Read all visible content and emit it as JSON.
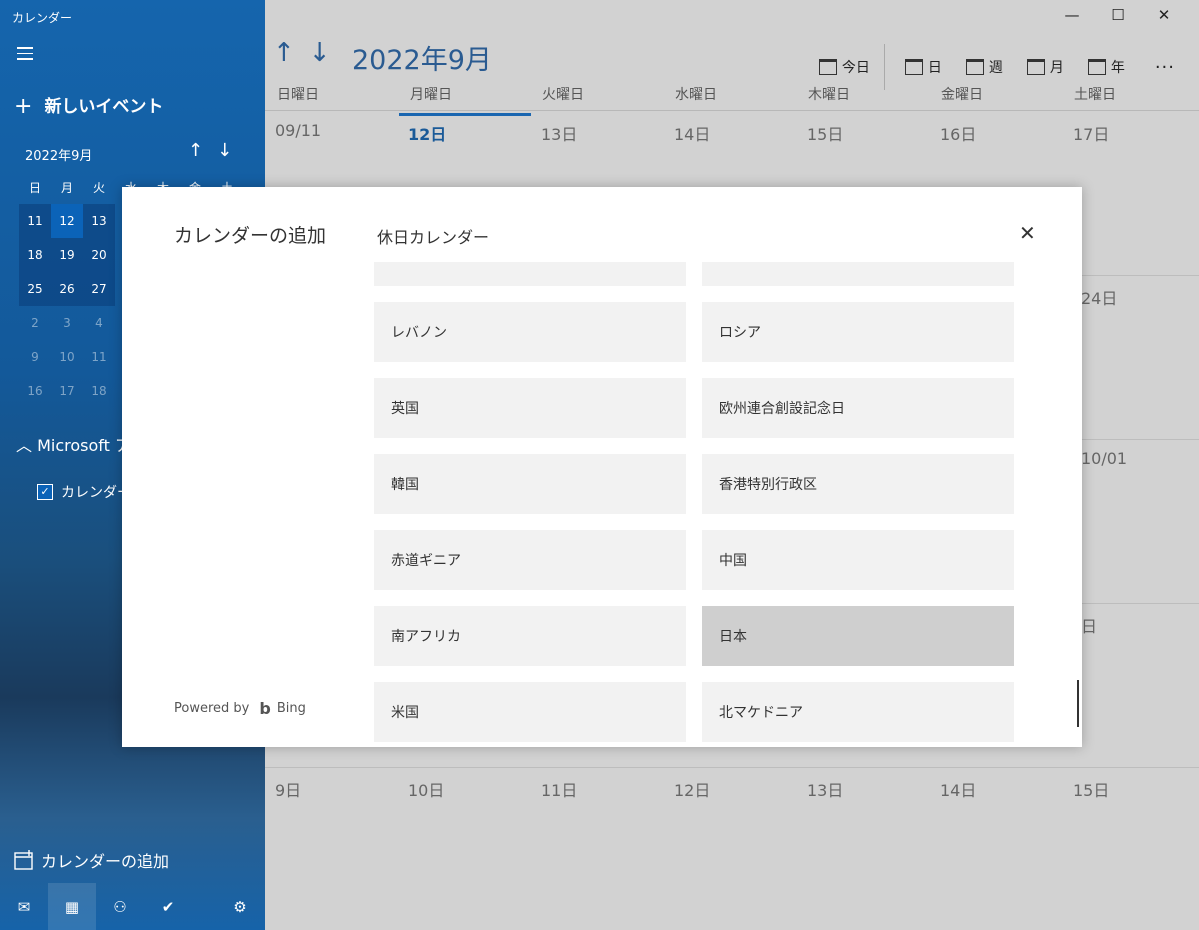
{
  "window": {
    "title": "カレンダー",
    "controls": [
      "—",
      "☐",
      "✕"
    ]
  },
  "sidebar": {
    "new_event": "新しいイベント",
    "mini_month": "2022年9月",
    "weekday_headers": [
      "日",
      "月",
      "火",
      "水",
      "木",
      "金",
      "土"
    ],
    "weeks": [
      [
        "11",
        "12",
        "13"
      ],
      [
        "18",
        "19",
        "20"
      ],
      [
        "25",
        "26",
        "27"
      ],
      [
        "2",
        "3",
        "4"
      ],
      [
        "9",
        "10",
        "11"
      ],
      [
        "16",
        "17",
        "18"
      ]
    ],
    "section": "Microsoft ア",
    "calendar_item": "カレンダー",
    "add_calendar": "カレンダーの追加",
    "bottom_icons": [
      "mail-icon",
      "calendar-icon",
      "people-icon",
      "todo-icon",
      "settings-icon"
    ]
  },
  "header": {
    "month_title": "2022年9月",
    "toolbar": {
      "today": "今日",
      "day": "日",
      "week": "週",
      "month": "月",
      "year": "年",
      "more": "···"
    }
  },
  "grid": {
    "weekdays": [
      "日曜日",
      "月曜日",
      "火曜日",
      "水曜日",
      "木曜日",
      "金曜日",
      "土曜日"
    ],
    "week1": [
      "09/11",
      "12日",
      "13日",
      "14日",
      "15日",
      "16日",
      "17日"
    ],
    "partial_right": [
      "24日",
      "10/01",
      "日"
    ],
    "last_week": [
      "9日",
      "10日",
      "11日",
      "12日",
      "13日",
      "14日",
      "15日"
    ]
  },
  "dialog": {
    "title": "カレンダーの追加",
    "subtitle": "休日カレンダー",
    "powered_by": "Powered by",
    "bing": "Bing",
    "countries_left": [
      "レバノン",
      "英国",
      "韓国",
      "赤道ギニア",
      "南アフリカ",
      "米国"
    ],
    "countries_right": [
      "ロシア",
      "欧州連合創設記念日",
      "香港特別行政区",
      "中国",
      "日本",
      "北マケドニア"
    ],
    "selected": "日本"
  },
  "colors": {
    "accent": "#1a5a98",
    "sidebar": "#1565ad"
  }
}
